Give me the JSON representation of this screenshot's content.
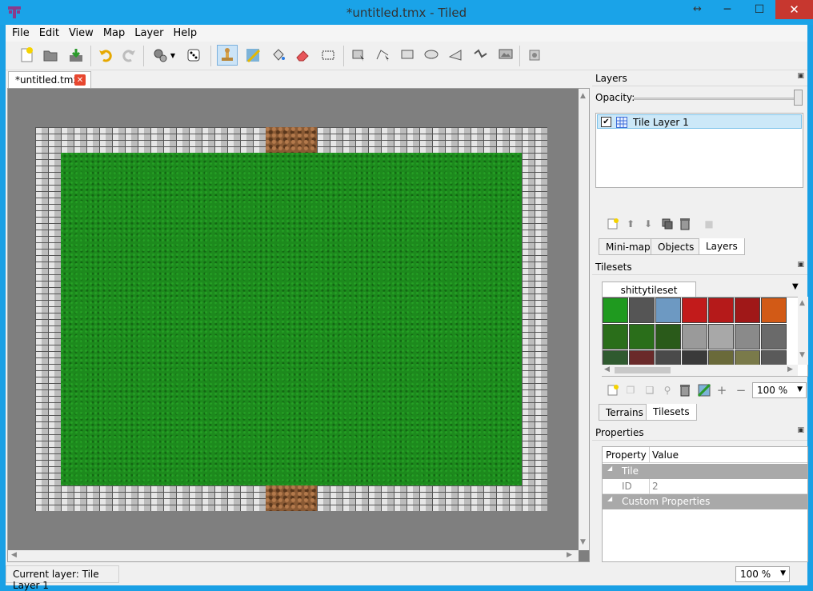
{
  "window": {
    "title": "*untitled.tmx - Tiled",
    "resize_glyph": "↔",
    "minimize": "─",
    "maximize": "☐",
    "close": "✕"
  },
  "menu": [
    "File",
    "Edit",
    "View",
    "Map",
    "Layer",
    "Help"
  ],
  "toolbar": {
    "icons": [
      "new-map-icon",
      "open-icon",
      "save-icon",
      "undo-icon",
      "redo-icon",
      "command-icon",
      "random-dice-icon",
      "stamp-brush-icon",
      "terrain-brush-icon",
      "bucket-fill-icon",
      "eraser-icon",
      "rect-select-icon",
      "select-objects-icon",
      "edit-polygons-icon",
      "insert-rectangle-icon",
      "insert-ellipse-icon",
      "insert-polygon-icon",
      "insert-polyline-icon",
      "insert-tile-icon",
      "magic-icon"
    ]
  },
  "document_tab": {
    "label": "*untitled.tmx"
  },
  "layers_panel": {
    "title": "Layers",
    "opacity_label": "Opacity:",
    "layers": [
      {
        "name": "Tile Layer 1",
        "visible": true
      }
    ],
    "tabs": [
      "Mini-map",
      "Objects",
      "Layers"
    ],
    "selected_tab": "Layers"
  },
  "tilesets_panel": {
    "title": "Tilesets",
    "tileset_tab": "shittytileset",
    "zoom": "100 %",
    "tabs": [
      "Terrains",
      "Tilesets"
    ],
    "selected_tab": "Tilesets",
    "tile_colors": [
      [
        "#1f9a1f",
        "#555555",
        "#6d99c2",
        "#c21b1b",
        "#b51a1a",
        "#a01818",
        "#d25a16"
      ],
      [
        "#2a6e1a",
        "#2a6e1a",
        "#2a5a1a",
        "#9a9a9a",
        "#a8a8a8",
        "#8a8a8a",
        "#6a6a6a"
      ],
      [
        "#2f5a2f",
        "#6a2a2a",
        "#4a4a4a",
        "#3a3a3a",
        "#6a6a3a",
        "#7a7a4a",
        "#5a5a5a"
      ]
    ]
  },
  "properties_panel": {
    "title": "Properties",
    "headers": [
      "Property",
      "Value"
    ],
    "group_tile": "Tile",
    "id_label": "ID",
    "id_value": "2",
    "group_custom": "Custom Properties"
  },
  "status": {
    "current_layer": "Current layer: Tile Layer 1",
    "zoom": "100 %"
  },
  "colors": {
    "accent": "#1aa3e8",
    "close": "#c7372f",
    "group_row": "#a9a9a9"
  }
}
